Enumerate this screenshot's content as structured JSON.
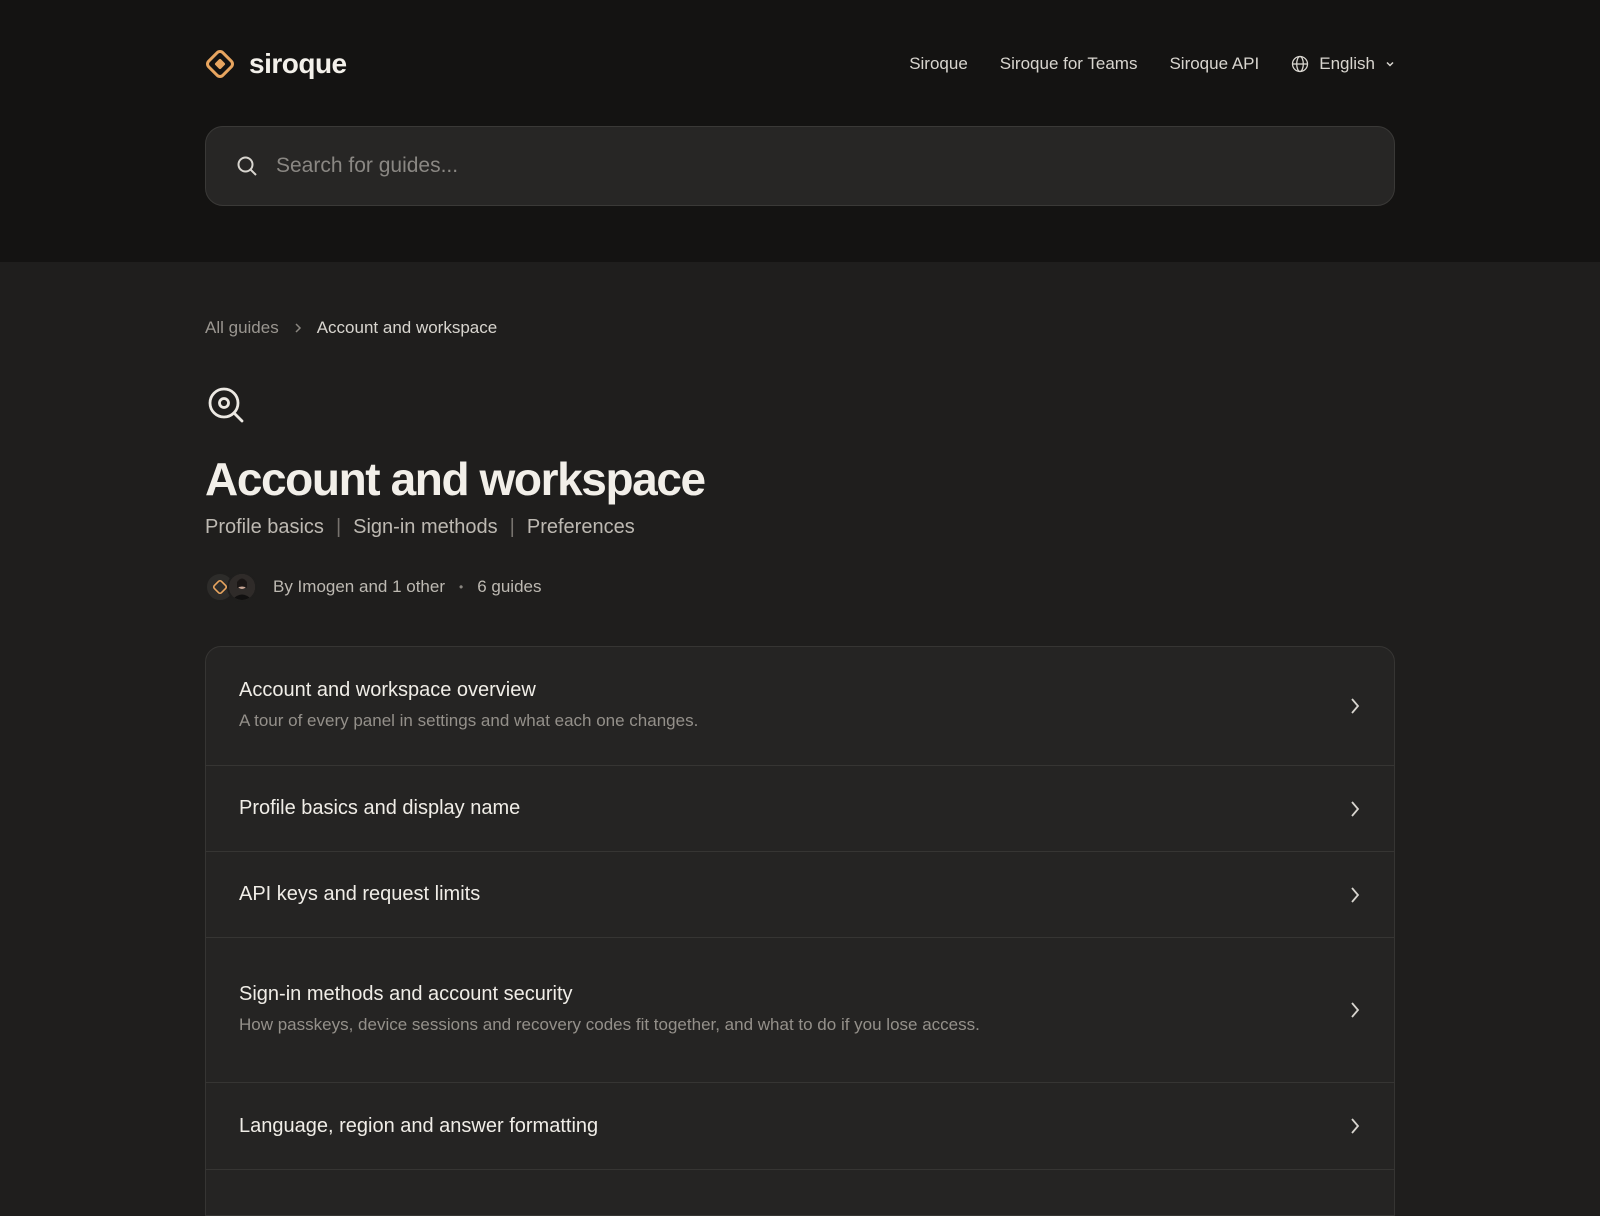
{
  "header": {
    "brand": "siroque",
    "nav": [
      {
        "label": "Siroque"
      },
      {
        "label": "Siroque for Teams"
      },
      {
        "label": "Siroque API"
      }
    ],
    "language": "English",
    "search_placeholder": "Search for guides..."
  },
  "breadcrumb": {
    "root": "All guides",
    "current": "Account and workspace"
  },
  "category": {
    "title": "Account and workspace",
    "tags": [
      "Profile basics",
      "Sign-in methods",
      "Preferences"
    ],
    "authors": "By Imogen and 1 other",
    "guide_count": "6 guides"
  },
  "guides": [
    {
      "title": "Account and workspace overview",
      "description": "A tour of every panel in settings and what each one changes."
    },
    {
      "title": "Profile basics and display name",
      "description": ""
    },
    {
      "title": "API keys and request limits",
      "description": ""
    },
    {
      "title": "Sign-in methods and account security",
      "description": "How passkeys, device sessions and recovery codes fit together, and what to do if you lose access."
    },
    {
      "title": "Language, region and answer formatting",
      "description": ""
    }
  ],
  "colors": {
    "brand_accent": "#e8a55f",
    "header_bg": "#141312",
    "page_bg": "#1f1e1d",
    "card_bg": "#252423"
  },
  "icons": {
    "logo": "diamond-logo-icon",
    "language": "globe-icon",
    "search": "search-icon",
    "category": "magnifier-target-icon",
    "row": "chevron-right-icon"
  }
}
